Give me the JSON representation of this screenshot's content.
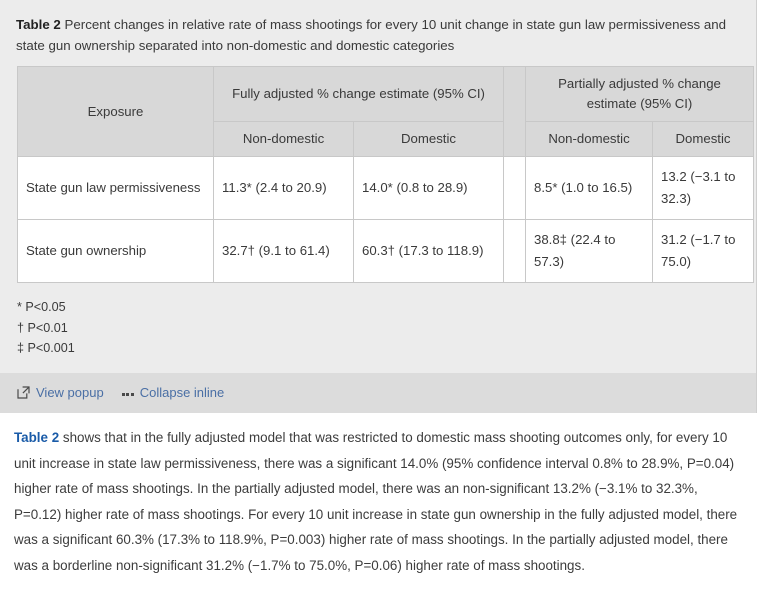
{
  "panel": {
    "caption_label": "Table 2",
    "caption_text": " Percent changes in relative rate of mass shootings for every 10 unit change in state gun law permissiveness and state gun ownership separated into non-domestic and domestic categories"
  },
  "table": {
    "exposure_header": "Exposure",
    "groups": [
      {
        "label": "Fully adjusted % change estimate (95% CI)"
      },
      {
        "label": "Partially adjusted % change estimate (95% CI)"
      }
    ],
    "subheaders": {
      "fully_non_domestic": "Non-domestic",
      "fully_domestic": "Domestic",
      "partially_non_domestic": "Non-domestic",
      "partially_domestic": "Domestic"
    },
    "rows": [
      {
        "exposure": "State gun law permissiveness",
        "fully_non_domestic": "11.3* (2.4 to 20.9)",
        "fully_domestic": "14.0* (0.8 to 28.9)",
        "partially_non_domestic": "8.5* (1.0 to 16.5)",
        "partially_domestic": "13.2 (−3.1 to 32.3)"
      },
      {
        "exposure": "State gun ownership",
        "fully_non_domestic": "32.7† (9.1 to 61.4)",
        "fully_domestic": "60.3† (17.3 to 118.9)",
        "partially_non_domestic": "38.8‡ (22.4 to 57.3)",
        "partially_domestic": "31.2 (−1.7 to 75.0)"
      }
    ]
  },
  "footnotes": [
    "* P<0.05",
    "† P<0.01",
    "‡ P<0.001"
  ],
  "actions": {
    "view_popup": "View popup",
    "collapse_inline": "Collapse inline"
  },
  "paragraph": {
    "link_label": "Table 2",
    "text": " shows that in the fully adjusted model that was restricted to domestic mass shooting outcomes only, for every 10 unit increase in state law permissiveness, there was a significant 14.0% (95% confidence interval 0.8% to 28.9%, P=0.04) higher rate of mass shootings. In the partially adjusted model, there was an non-significant 13.2% (−3.1% to 32.3%, P=0.12) higher rate of mass shootings. For every 10 unit increase in state gun ownership in the fully adjusted model, there was a significant 60.3% (17.3% to 118.9%, P=0.003) higher rate of mass shootings. In the partially adjusted model, there was a borderline non-significant 31.2% (−1.7% to 75.0%, P=0.06) higher rate of mass shootings."
  },
  "colors": {
    "panel_bg": "#ececec",
    "action_bar_bg": "#dcdcdc",
    "table_header_bg": "#d8d8d8",
    "link": "#4a6fa5",
    "paragraph_link": "#1a5ba8",
    "border": "#c8c8c8"
  }
}
